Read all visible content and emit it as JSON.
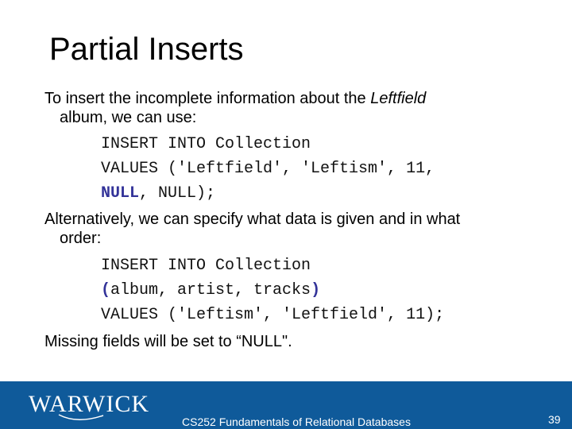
{
  "slide": {
    "title": "Partial Inserts",
    "para1": {
      "before": "To insert the incomplete information about the ",
      "emphasis": "Leftfield",
      "continuation": "album, we can use:"
    },
    "code1": {
      "line1": "INSERT INTO Collection",
      "line2": "VALUES ('Leftfield', 'Leftism', 11,",
      "line3_highlight": "NULL",
      "line3_rest": ", NULL);"
    },
    "para2": {
      "line1": "Alternatively, we can specify what data is given and in what",
      "continuation": "order:"
    },
    "code2": {
      "line1": "INSERT INTO Collection",
      "line2_open": "(",
      "line2_mid": "album, artist, tracks",
      "line2_close": ")",
      "line3": "VALUES ('Leftism', 'Leftfield', 11);"
    },
    "para3": "Missing fields will be set to “NULL\"."
  },
  "footer": {
    "logo": "WARWICK",
    "course": "CS252 Fundamentals of Relational Databases",
    "page_number": "39",
    "background_color": "#0f5a9a"
  }
}
